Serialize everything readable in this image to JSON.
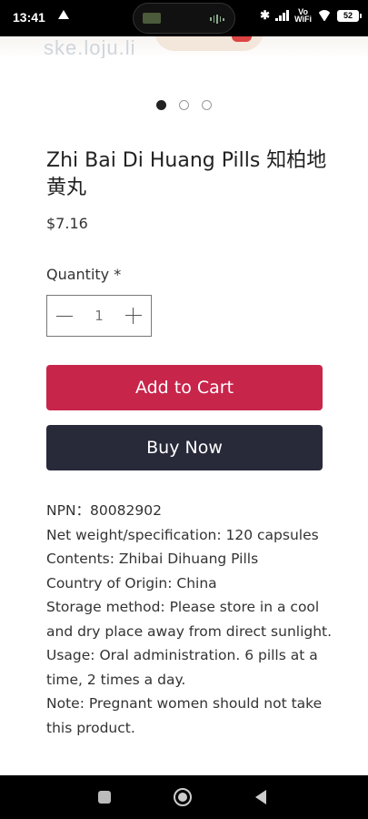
{
  "status_bar": {
    "time": "13:41",
    "network_label": "Vo\nWiFi",
    "battery": "52"
  },
  "watermark": "ske.loju.li",
  "carousel": {
    "total": 3,
    "active_index": 0
  },
  "product": {
    "title": "Zhi Bai Di Huang Pills 知柏地黄丸",
    "price": "$7.16",
    "quantity_label": "Quantity *",
    "quantity_value": "1"
  },
  "actions": {
    "add_to_cart": "Add to Cart",
    "buy_now": "Buy Now"
  },
  "details": [
    "NPN：80082902",
    "Net weight/specification: 120 capsules",
    "Contents: Zhibai Dihuang Pills",
    "Country of Origin: China",
    "Storage method: Please store in a cool and dry place away from direct sunlight.",
    "Usage: Oral administration. 6 pills at a time, 2 times a day.",
    "Note: Pregnant women should not take this product."
  ],
  "colors": {
    "add_to_cart_bg": "#c8254b",
    "buy_now_bg": "#282a3a"
  }
}
